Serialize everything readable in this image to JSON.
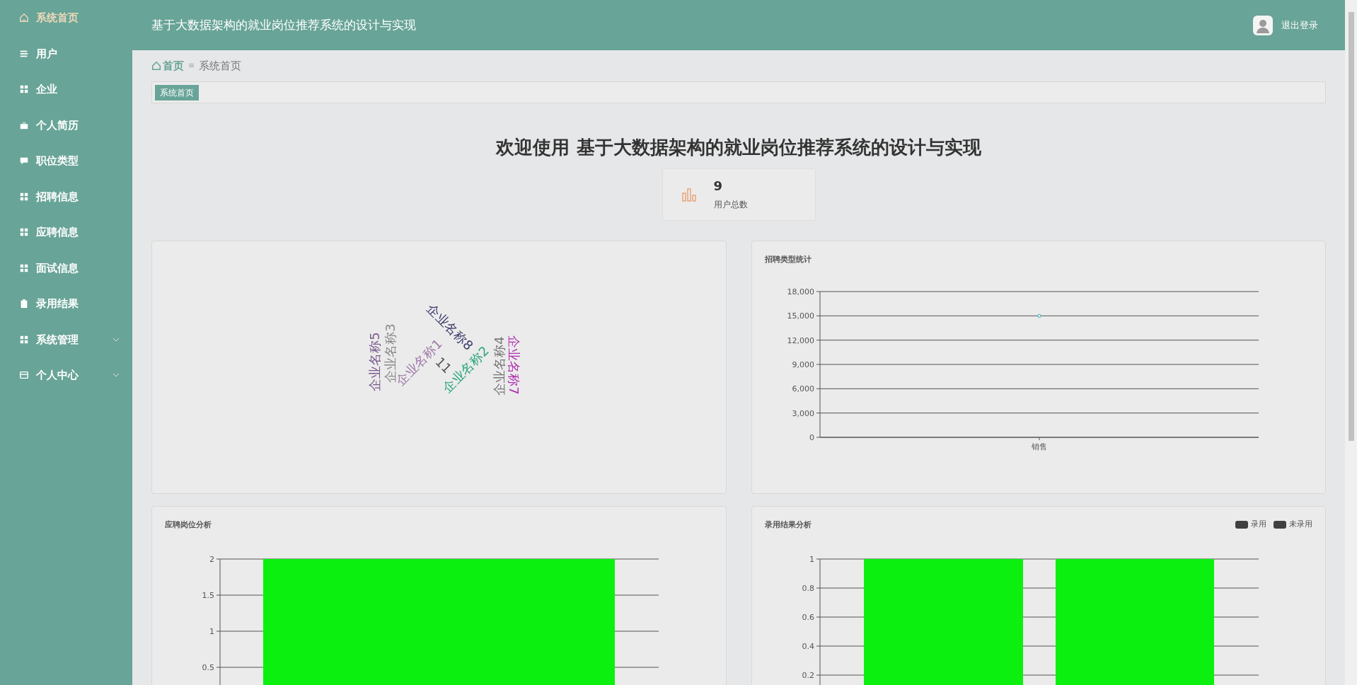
{
  "sidebar": {
    "items": [
      {
        "label": "系统首页",
        "kind": "home",
        "selected": true,
        "has_submenu": false
      },
      {
        "label": "用户",
        "kind": "list",
        "selected": false,
        "has_submenu": false
      },
      {
        "label": "企业",
        "kind": "grid",
        "selected": false,
        "has_submenu": false
      },
      {
        "label": "个人简历",
        "kind": "briefcase",
        "selected": false,
        "has_submenu": false
      },
      {
        "label": "职位类型",
        "kind": "chat",
        "selected": false,
        "has_submenu": false
      },
      {
        "label": "招聘信息",
        "kind": "grid",
        "selected": false,
        "has_submenu": false
      },
      {
        "label": "应聘信息",
        "kind": "grid",
        "selected": false,
        "has_submenu": false
      },
      {
        "label": "面试信息",
        "kind": "grid",
        "selected": false,
        "has_submenu": false
      },
      {
        "label": "录用结果",
        "kind": "clipboard",
        "selected": false,
        "has_submenu": false
      },
      {
        "label": "系统管理",
        "kind": "grid",
        "selected": false,
        "has_submenu": true
      },
      {
        "label": "个人中心",
        "kind": "card",
        "selected": false,
        "has_submenu": true
      }
    ]
  },
  "header": {
    "title": "基于大数据架构的就业岗位推荐系统的设计与实现",
    "logout": "退出登录"
  },
  "breadcrumb": {
    "home": "首页",
    "separator": "≡",
    "current": "系统首页"
  },
  "tags": [
    {
      "label": "系统首页",
      "selected": true
    }
  ],
  "welcome": "欢迎使用 基于大数据架构的就业岗位推荐系统的设计与实现",
  "stat": {
    "value": "9",
    "label": "用户总数"
  },
  "word_cloud": {
    "words": [
      {
        "text": "企业名称5",
        "kind": "up",
        "color": "#7a5a8e"
      },
      {
        "text": "企业名称3",
        "kind": "up",
        "color": "#8a8a8a"
      },
      {
        "text": "企业名称1",
        "kind": "rise",
        "color": "#a07aaa"
      },
      {
        "text": "11",
        "kind": "fall",
        "color": "#555555"
      },
      {
        "text": "企业名称8",
        "kind": "fall",
        "color": "#3c3c6e"
      },
      {
        "text": "企业名称2",
        "kind": "rise",
        "color": "#2aa67a"
      },
      {
        "text": "企业名称4",
        "kind": "up",
        "color": "#777777"
      },
      {
        "text": "企业名称7",
        "kind": "down",
        "color": "#b030b0"
      }
    ]
  },
  "type_chart": {
    "title": "招聘类型统计",
    "chart_data": {
      "type": "line",
      "grid": true,
      "categories": [
        "销售"
      ],
      "series": [
        {
          "color": "#5fb8c0",
          "marker": true,
          "values": [
            15000
          ]
        }
      ],
      "ylim": [
        0,
        18000
      ],
      "yticks": [
        {
          "value": 0,
          "label": "0"
        },
        {
          "value": 3000,
          "label": "3,000"
        },
        {
          "value": 6000,
          "label": "6,000"
        },
        {
          "value": 9000,
          "label": "9,000"
        },
        {
          "value": 12000,
          "label": "12,000"
        },
        {
          "value": 15000,
          "label": "15,000"
        },
        {
          "value": 18000,
          "label": "18,000"
        }
      ]
    }
  },
  "position_chart": {
    "title": "应聘岗位分析",
    "chart_data": {
      "type": "bar",
      "grid": true,
      "series": [
        {
          "color": "#0cf010",
          "values": [
            2
          ]
        }
      ],
      "ylim": [
        0,
        2
      ],
      "yticks": [
        0.5,
        1,
        1.5,
        2
      ]
    }
  },
  "result_chart": {
    "title": "录用结果分析",
    "legend": [
      {
        "label": "录用",
        "color": "#404040"
      },
      {
        "label": "未录用",
        "color": "#404040"
      }
    ],
    "chart_data": {
      "type": "bar",
      "grid": true,
      "series": [
        {
          "color": "#0cf010",
          "values": [
            1,
            1
          ]
        }
      ],
      "ylim": [
        0,
        1
      ],
      "yticks": [
        0.2,
        0.4,
        0.6,
        0.8,
        1
      ]
    }
  }
}
